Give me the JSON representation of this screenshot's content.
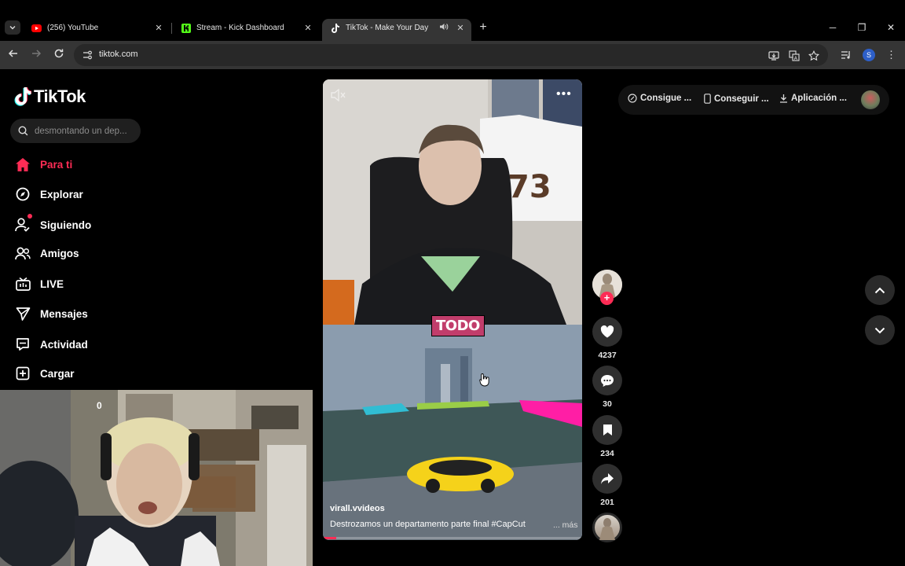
{
  "browser": {
    "tabs": [
      {
        "title": "(256) YouTube",
        "icon": "youtube-icon"
      },
      {
        "title": "Stream - Kick Dashboard",
        "icon": "kick-icon"
      },
      {
        "title": "TikTok - Make Your Day",
        "icon": "tiktok-icon",
        "active": true,
        "audio": true
      }
    ],
    "url": "tiktok.com",
    "profile_initial": "S"
  },
  "sidebar": {
    "logo_text": "TikTok",
    "search_placeholder": "desmontando un dep...",
    "nav": [
      {
        "label": "Para ti",
        "icon": "home-icon",
        "active": true
      },
      {
        "label": "Explorar",
        "icon": "compass-icon"
      },
      {
        "label": "Siguiendo",
        "icon": "following-icon",
        "badge": true
      },
      {
        "label": "Amigos",
        "icon": "friends-icon"
      },
      {
        "label": "LIVE",
        "icon": "live-icon"
      },
      {
        "label": "Mensajes",
        "icon": "messages-icon"
      },
      {
        "label": "Actividad",
        "icon": "activity-icon"
      },
      {
        "label": "Cargar",
        "icon": "upload-icon"
      }
    ]
  },
  "webcam": {
    "counter": "0"
  },
  "video": {
    "caption_overlay": "TODO",
    "author": "virall.vvideos",
    "description": "Destrozamos un departamento parte final #CapCut",
    "more_label": "... más",
    "progress": 0.05
  },
  "actions": {
    "likes": "4237",
    "comments": "30",
    "saves": "234",
    "shares": "201"
  },
  "top_bar": {
    "coins_label": "Consigue ...",
    "app_label": "Conseguir ...",
    "download_label": "Aplicación ..."
  },
  "colors": {
    "accent": "#fe2c55",
    "background": "#000000",
    "chrome_toolbar": "#353535"
  }
}
